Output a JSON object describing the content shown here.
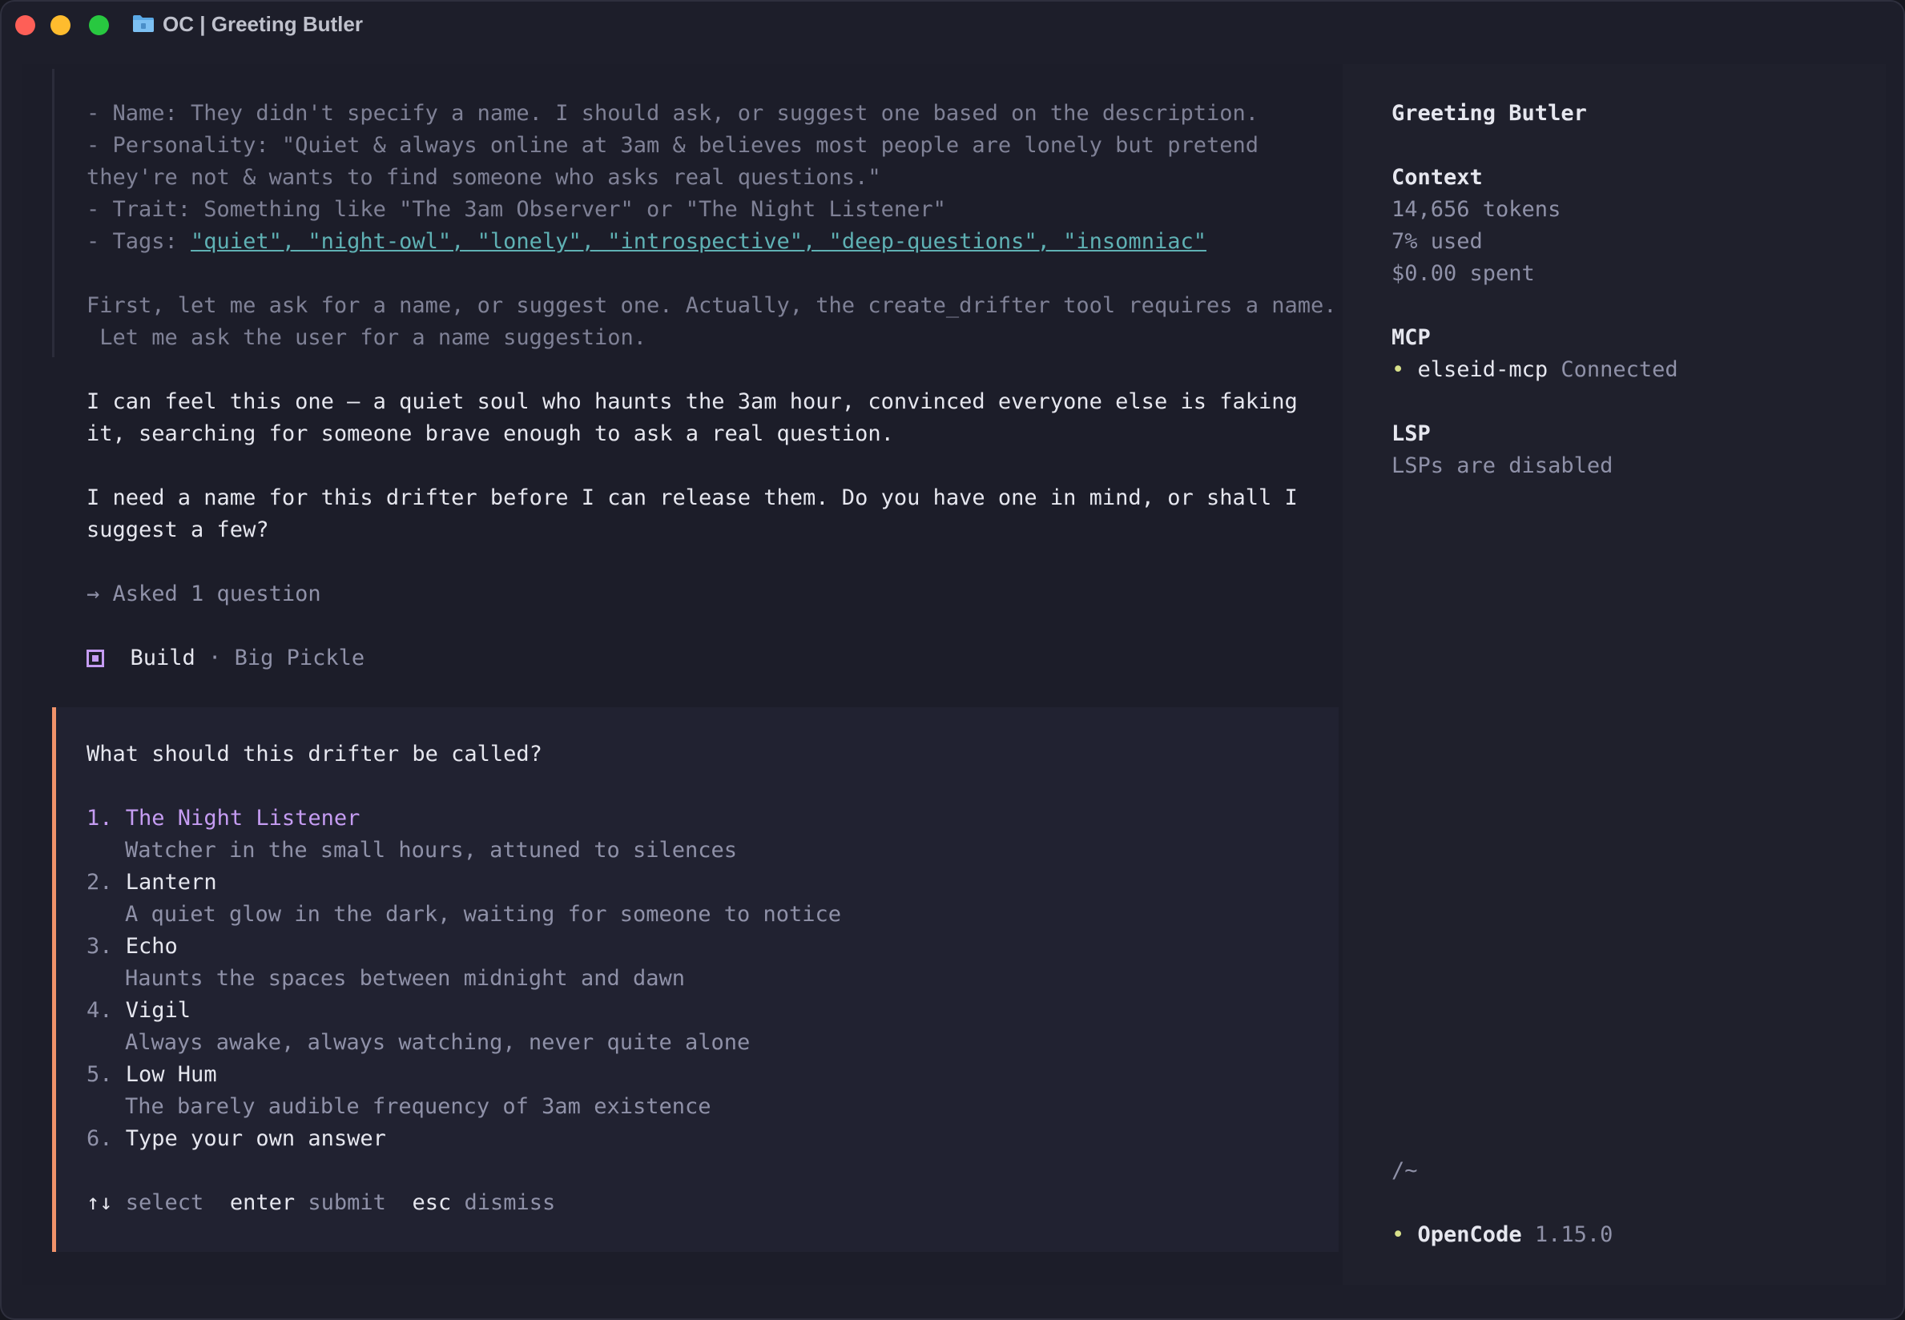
{
  "window": {
    "title": "OC | Greeting Butler"
  },
  "thinking": {
    "lines": [
      "- Name: They didn't specify a name. I should ask, or suggest one based on the description.",
      "- Personality: \"Quiet & always online at 3am & believes most people are lonely but pretend",
      "they're not & wants to find someone who asks real questions.\"",
      "- Trait: Something like \"The 3am Observer\" or \"The Night Listener\""
    ],
    "tags_prefix": "- Tags: ",
    "tags_value": "\"quiet\", \"night-owl\", \"lonely\", \"introspective\", \"deep-questions\", \"insomniac\"",
    "para2": [
      "First, let me ask for a name, or suggest one. Actually, the create_drifter tool requires a name.",
      " Let me ask the user for a name suggestion."
    ]
  },
  "response": {
    "para1": [
      "I can feel this one — a quiet soul who haunts the 3am hour, convinced everyone else is faking",
      "it, searching for someone brave enough to ask a real question."
    ],
    "para2": [
      "I need a name for this drifter before I can release them. Do you have one in mind, or shall I",
      "suggest a few?"
    ],
    "asked": "→ Asked 1 question"
  },
  "build": {
    "mode": "Build",
    "separator": " · ",
    "model": "Big Pickle"
  },
  "question": {
    "prompt": "What should this drifter be called?",
    "options": [
      {
        "num": "1.",
        "label": "The Night Listener",
        "desc": "Watcher in the small hours, attuned to silences",
        "selected": true
      },
      {
        "num": "2.",
        "label": "Lantern",
        "desc": "A quiet glow in the dark, waiting for someone to notice"
      },
      {
        "num": "3.",
        "label": "Echo",
        "desc": "Haunts the spaces between midnight and dawn"
      },
      {
        "num": "4.",
        "label": "Vigil",
        "desc": "Always awake, always watching, never quite alone"
      },
      {
        "num": "5.",
        "label": "Low Hum",
        "desc": "The barely audible frequency of 3am existence"
      },
      {
        "num": "6.",
        "label": "Type your own answer",
        "desc": ""
      }
    ],
    "hints": {
      "select_key": "↑↓",
      "select_label": "select",
      "submit_key": "enter",
      "submit_label": "submit",
      "dismiss_key": "esc",
      "dismiss_label": "dismiss"
    }
  },
  "sidebar": {
    "title": "Greeting Butler",
    "context_heading": "Context",
    "tokens": "14,656 tokens",
    "used": "7% used",
    "spent": "$0.00 spent",
    "mcp_heading": "MCP",
    "mcp_name": "elseid-mcp",
    "mcp_status": "Connected",
    "lsp_heading": "LSP",
    "lsp_status": "LSPs are disabled",
    "cwd": "/~",
    "app_name": "OpenCode",
    "app_version": "1.15.0"
  },
  "colors": {
    "accent_orange": "#f0926a",
    "accent_purple": "#c59cf2",
    "link_teal": "#5fb1b4",
    "status_green": "#d8e08a"
  }
}
